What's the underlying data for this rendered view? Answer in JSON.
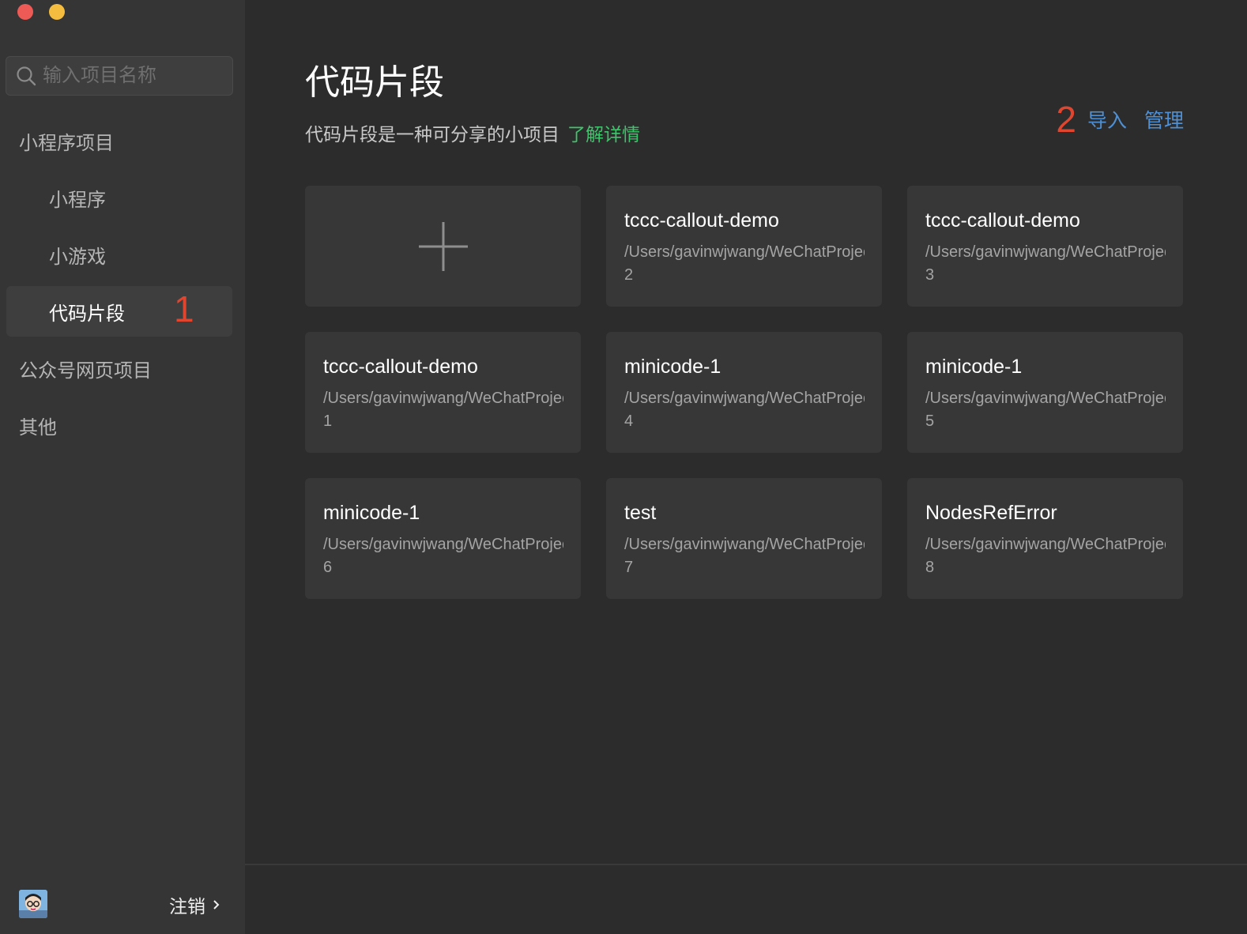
{
  "sidebar": {
    "search_placeholder": "输入项目名称",
    "nav": [
      {
        "label": "小程序项目"
      },
      {
        "label": "小程序"
      },
      {
        "label": "小游戏"
      },
      {
        "label": "代码片段"
      },
      {
        "label": "公众号网页项目"
      },
      {
        "label": "其他"
      }
    ],
    "marker": "1",
    "logout_label": "注销"
  },
  "main": {
    "title": "代码片段",
    "subtitle": "代码片段是一种可分享的小项目",
    "learn_more": "了解详情",
    "marker": "2",
    "import_label": "导入",
    "manage_label": "管理",
    "cards": [
      {
        "name": "tccc-callout-demo",
        "path": "/Users/gavinwjwang/WeChatProjects",
        "num": "2"
      },
      {
        "name": "tccc-callout-demo",
        "path": "/Users/gavinwjwang/WeChatProjects",
        "num": "3"
      },
      {
        "name": "tccc-callout-demo",
        "path": "/Users/gavinwjwang/WeChatProjects",
        "num": "1"
      },
      {
        "name": "minicode-1",
        "path": "/Users/gavinwjwang/WeChatProjects",
        "num": "4"
      },
      {
        "name": "minicode-1",
        "path": "/Users/gavinwjwang/WeChatProjects",
        "num": "5"
      },
      {
        "name": "minicode-1",
        "path": "/Users/gavinwjwang/WeChatProjects",
        "num": "6"
      },
      {
        "name": "test",
        "path": "/Users/gavinwjwang/WeChatProjects",
        "num": "7"
      },
      {
        "name": "NodesRefError",
        "path": "/Users/gavinwjwang/WeChatProjects",
        "num": "8"
      }
    ]
  },
  "colors": {
    "accent_green": "#3ec56b",
    "link_blue": "#4f8fd3",
    "marker_red": "#e0452f"
  }
}
